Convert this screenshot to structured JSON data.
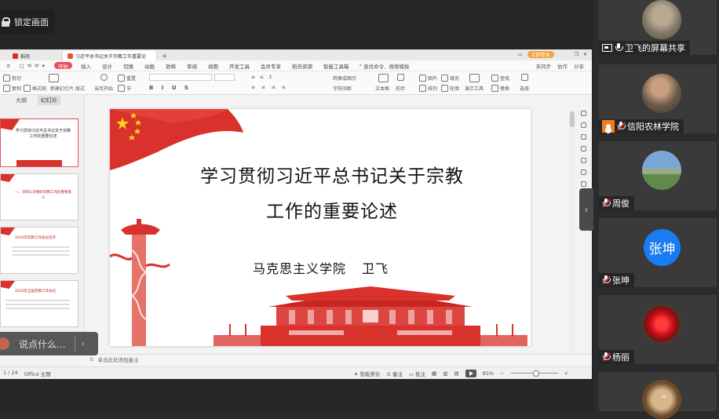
{
  "lock_screen": {
    "label": "锁定画面"
  },
  "wps": {
    "tabs": [
      {
        "label": "稻壳",
        "active": false
      },
      {
        "label": "习近平总书记关于宗教工作重要论述",
        "active": true
      }
    ],
    "login": "立即登录",
    "menu": [
      "开始",
      "插入",
      "设计",
      "切换",
      "动画",
      "放映",
      "审阅",
      "视图",
      "开发工具",
      "会员专享",
      "稻壳资源",
      "智能工具箱"
    ],
    "menu_active": "开始",
    "menu_search": "查找命令、搜索模板",
    "menu_right": [
      "未同步",
      "协作",
      "分享"
    ],
    "ribbon": {
      "cut": "剪切",
      "copy": "复制",
      "format_painter": "格式刷",
      "new_slide": "新建幻灯片",
      "layout": "版式",
      "play_current": "当页开始",
      "reset": "重置",
      "section": "节",
      "text_box": "文本框",
      "shape": "形状",
      "arrange": "排列",
      "outline": "轮廓",
      "present_tool": "演示工具",
      "find": "查找",
      "replace": "替换",
      "select": "选择",
      "picture": "图片",
      "fill": "填充",
      "convert_smart": "转换成图示",
      "char_spacing": "字符间距"
    },
    "panel_tabs": [
      "大纲",
      "幻灯片"
    ],
    "panel_active": "幻灯片",
    "thumbs": [
      {
        "title": "学习贯彻习近平总书记关于宗教工作的重要论述"
      },
      {
        "title": "一、深刻认识做好宗教工作的重要意义"
      },
      {
        "title": "2014年宗教工作会议召开"
      },
      {
        "title": "2016年全国宗教工作会议"
      }
    ],
    "slide": {
      "title_line1": "学习贯彻习近平总书记关于宗教",
      "title_line2": "工作的重要论述",
      "org": "马克思主义学院",
      "author": "卫飞"
    },
    "notes_placeholder": "单击此处添加备注",
    "status": {
      "page": "1 / 24",
      "theme": "Office 主题",
      "beautify": "智能美化",
      "notes": "备注",
      "comment": "批注",
      "zoom": "85%"
    }
  },
  "chat": {
    "placeholder": "说点什么..."
  },
  "participants": [
    {
      "name": "卫飞的屏幕共享",
      "type": "screen-share"
    },
    {
      "name": "信阳农林学院",
      "type": "host"
    },
    {
      "name": "周俊",
      "type": "muted"
    },
    {
      "name": "张坤",
      "type": "muted",
      "initial": "张坤"
    },
    {
      "name": "杨丽",
      "type": "muted"
    }
  ],
  "colors": {
    "accent": "#e8505b",
    "flag_red": "#d9312b",
    "avatar_blue": "#1a7cf2",
    "host_orange": "#f37b1d"
  }
}
